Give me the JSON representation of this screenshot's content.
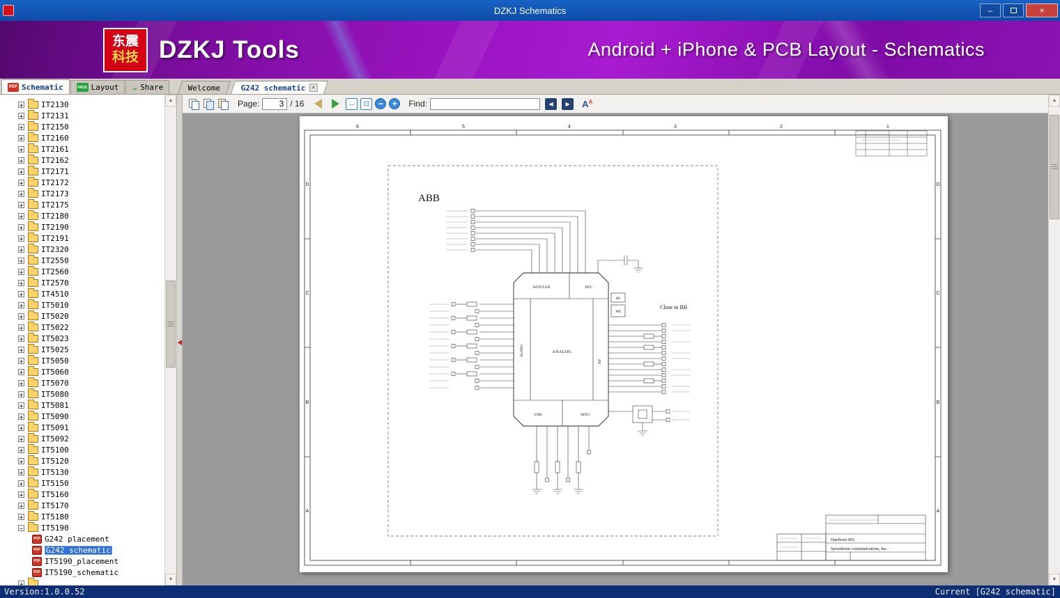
{
  "window": {
    "title": "DZKJ Schematics",
    "controls": {
      "minimize": "–",
      "close": "×"
    }
  },
  "banner": {
    "logo": {
      "line1": "东震",
      "line2": "科技"
    },
    "app_name": "DZKJ Tools",
    "tagline": "Android + iPhone & PCB Layout - Schematics"
  },
  "icons": {
    "pdf_badge": "PDF",
    "pads_badge": "PADS",
    "share_cloud": "☁"
  },
  "mode_tabs": [
    {
      "label": "Schematic",
      "active": true
    },
    {
      "label": "Layout",
      "active": false
    },
    {
      "label": "Share",
      "active": false
    }
  ],
  "doc_tabs": [
    {
      "label": "Welcome",
      "active": false
    },
    {
      "label": "G242 schematic",
      "active": true,
      "close": "×"
    }
  ],
  "toolbar": {
    "page_label": "Page:",
    "page_value": "3",
    "page_total": "/ 16",
    "find_label": "Find:",
    "find_value": ""
  },
  "sidebar": {
    "tree": [
      {
        "label": "IT2130",
        "type": "folder"
      },
      {
        "label": "IT2131",
        "type": "folder"
      },
      {
        "label": "IT2150",
        "type": "folder"
      },
      {
        "label": "IT2160",
        "type": "folder"
      },
      {
        "label": "IT2161",
        "type": "folder"
      },
      {
        "label": "IT2162",
        "type": "folder"
      },
      {
        "label": "IT2171",
        "type": "folder"
      },
      {
        "label": "IT2172",
        "type": "folder"
      },
      {
        "label": "IT2173",
        "type": "folder"
      },
      {
        "label": "IT2175",
        "type": "folder"
      },
      {
        "label": "IT2180",
        "type": "folder"
      },
      {
        "label": "IT2190",
        "type": "folder"
      },
      {
        "label": "IT2191",
        "type": "folder"
      },
      {
        "label": "IT2320",
        "type": "folder"
      },
      {
        "label": "IT2550",
        "type": "folder"
      },
      {
        "label": "IT2560",
        "type": "folder"
      },
      {
        "label": "IT2570",
        "type": "folder"
      },
      {
        "label": "IT4510",
        "type": "folder"
      },
      {
        "label": "IT5010",
        "type": "folder"
      },
      {
        "label": "IT5020",
        "type": "folder"
      },
      {
        "label": "IT5022",
        "type": "folder"
      },
      {
        "label": "IT5023",
        "type": "folder"
      },
      {
        "label": "IT5025",
        "type": "folder"
      },
      {
        "label": "IT5050",
        "type": "folder"
      },
      {
        "label": "IT5060",
        "type": "folder"
      },
      {
        "label": "IT5070",
        "type": "folder"
      },
      {
        "label": "IT5080",
        "type": "folder"
      },
      {
        "label": "IT5081",
        "type": "folder"
      },
      {
        "label": "IT5090",
        "type": "folder"
      },
      {
        "label": "IT5091",
        "type": "folder"
      },
      {
        "label": "IT5092",
        "type": "folder"
      },
      {
        "label": "IT5100",
        "type": "folder"
      },
      {
        "label": "IT5120",
        "type": "folder"
      },
      {
        "label": "IT5130",
        "type": "folder"
      },
      {
        "label": "IT5150",
        "type": "folder"
      },
      {
        "label": "IT5160",
        "type": "folder"
      },
      {
        "label": "IT5170",
        "type": "folder"
      },
      {
        "label": "IT5180",
        "type": "folder"
      },
      {
        "label": "IT5190",
        "type": "folder-open"
      },
      {
        "label": "G242 placement",
        "type": "pdf"
      },
      {
        "label": "G242 schematic",
        "type": "pdf",
        "selected": true
      },
      {
        "label": "IT5190_placement",
        "type": "pdf"
      },
      {
        "label": "IT5190_schematic",
        "type": "pdf"
      },
      {
        "label": "",
        "type": "folder"
      }
    ]
  },
  "schematic": {
    "block_title": "ABB",
    "note": "Close to BB",
    "chip": {
      "top_left": "WDT/LED",
      "top_right": "RTC",
      "left": "AUDIO",
      "center": "ANALOG",
      "bottom_left": "USB",
      "bottom_right": "ADC1",
      "right": "RF",
      "right_box1": "RF",
      "right_box2": "PM"
    },
    "grid_columns": [
      "6",
      "5",
      "4",
      "3",
      "2",
      "1"
    ],
    "grid_rows": [
      "D",
      "C",
      "B",
      "A"
    ],
    "title_block": {
      "line1": "Hardware RD.",
      "line2": "Spreadtrum communications, Inc."
    }
  },
  "status_bar": {
    "left": "Version:1.0.0.52",
    "right": "Current [G242 schematic]"
  }
}
